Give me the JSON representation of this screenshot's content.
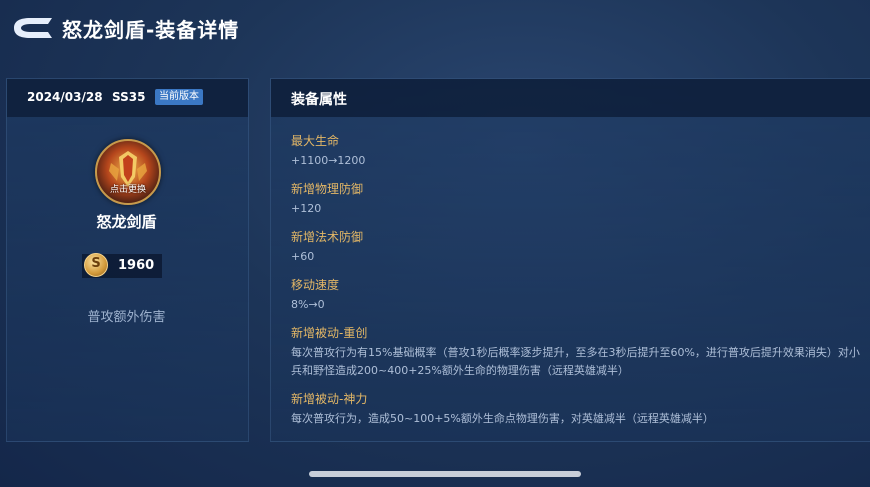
{
  "header": {
    "title": "怒龙剑盾-装备详情"
  },
  "left": {
    "date": "2024/03/28",
    "season": "SS35",
    "badge": "当前版本",
    "icon_caption": "点击更换",
    "item_name": "怒龙剑盾",
    "price": "1960",
    "description": "普攻额外伤害"
  },
  "right": {
    "section_title": "装备属性",
    "attributes": [
      {
        "name": "最大生命",
        "value": "+1100→1200"
      },
      {
        "name": "新增物理防御",
        "value": "+120"
      },
      {
        "name": "新增法术防御",
        "value": "+60"
      },
      {
        "name": "移动速度",
        "value": "8%→0"
      },
      {
        "name": "新增被动-重创",
        "value": "每次普攻行为有15%基础概率（普攻1秒后概率逐步提升，至多在3秒后提升至60%，进行普攻后提升效果消失）对小兵和野怪造成200~400+25%额外生命的物理伤害（远程英雄减半）"
      },
      {
        "name": "新增被动-神力",
        "value": "每次普攻行为，造成50~100+5%额外生命点物理伤害，对英雄减半（远程英雄减半）"
      }
    ]
  },
  "colors": {
    "accent_gold": "#e3b766",
    "badge_blue": "#3b78c4"
  },
  "icons": {
    "back": "back-arrow-icon",
    "coin": "gold-coin-icon"
  }
}
